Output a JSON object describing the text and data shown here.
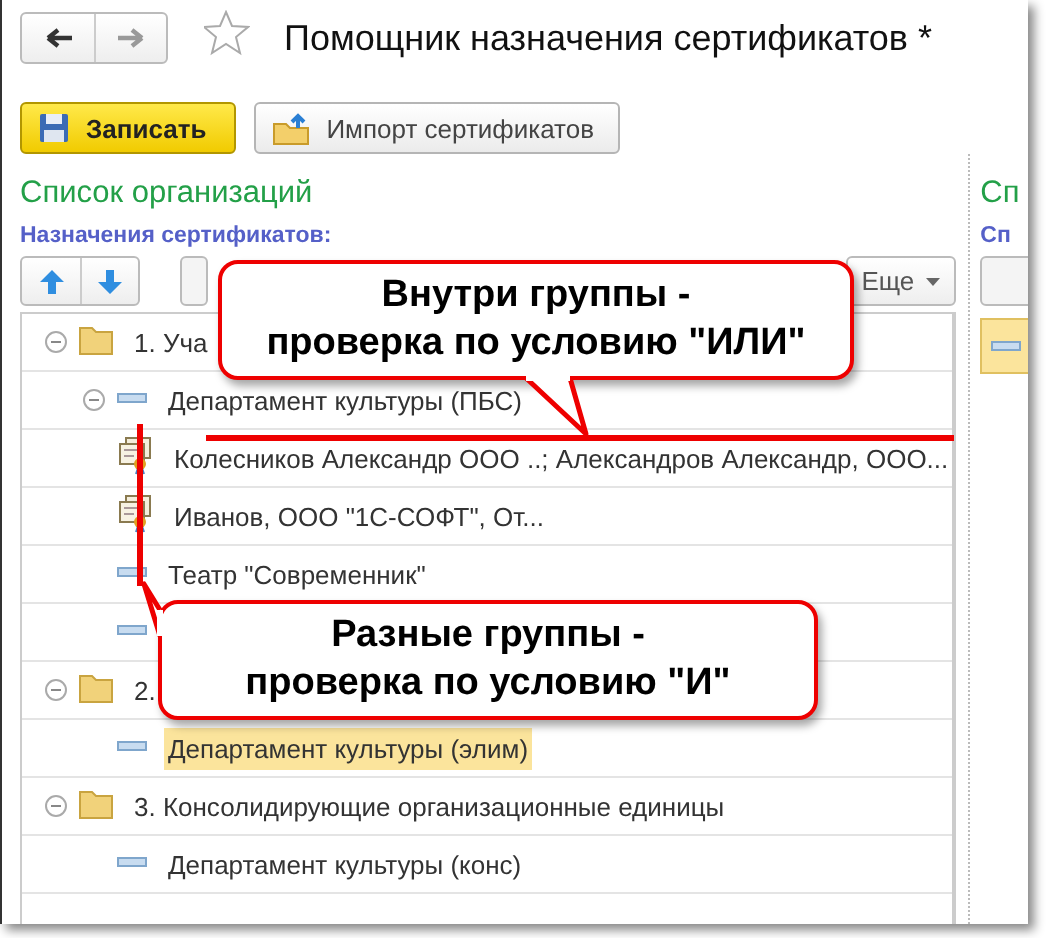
{
  "window": {
    "title": "Помощник назначения сертификатов *",
    "favorite": false
  },
  "toolbar": [
    {
      "kind": "save",
      "label": "Записать"
    },
    {
      "kind": "import",
      "label": "Импорт сертификатов"
    }
  ],
  "section_title": "Список организаций",
  "tree_caption": "Назначения сертификатов:",
  "tree_toolbar": {
    "more": "Еще"
  },
  "tree": [
    {
      "kind": "group",
      "label": "1. Уча",
      "expanded": true,
      "selected": false,
      "children": [
        {
          "kind": "item",
          "label": "Департамент культуры (ПБС)",
          "expanded": true,
          "selected": false,
          "children": [
            {
              "kind": "cert",
              "label": "Колесников Александр ООО ..; Александров Александр, ООО...",
              "selected": false
            },
            {
              "kind": "cert",
              "label": "Иванов, ООО \"1С-СОФТ\", От...",
              "selected": false
            }
          ]
        },
        {
          "kind": "item",
          "label": "Театр \"Современник\"",
          "selected": false
        },
        {
          "kind": "item",
          "selected": false
        }
      ]
    },
    {
      "kind": "group",
      "label": "2.",
      "expanded": true,
      "selected": false,
      "children": [
        {
          "kind": "item",
          "label": "Департамент культуры (элим)",
          "selected": true
        }
      ]
    },
    {
      "kind": "group",
      "label": "3. Консолидирующие организационные единицы",
      "expanded": true,
      "selected": false,
      "children": [
        {
          "kind": "item",
          "label": "Департамент культуры (конс)",
          "selected": false
        }
      ]
    }
  ],
  "side_panel": {
    "title": "Сп",
    "caption": "Сп"
  },
  "callouts": [
    {
      "text": "Внутри группы -\nпроверка по условию \"ИЛИ\""
    },
    {
      "text": "Разные группы -\nпроверка по условию \"И\""
    }
  ]
}
